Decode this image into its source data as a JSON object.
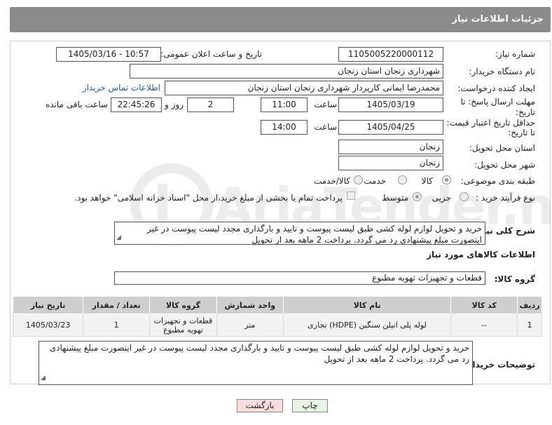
{
  "page": {
    "title": "جزئیات اطلاعات نیاز"
  },
  "fields": {
    "need_number_label": "شماره نیاز:",
    "need_number": "1105005220000112",
    "announce_label": "تاریخ و ساعت اعلان عمومی:",
    "announce_value": "1405/03/16 - 10:57",
    "buyer_org_label": "نام دستگاه خریدار:",
    "buyer_org": "شهرداری زنجان استان زنجان",
    "creator_label": "ایجاد کننده درخواست:",
    "creator": "محمدرضا  ایمانی کارپرداز شهرداری زنجان استان زنجان",
    "contact_link": "اطلاعات تماس خریدار",
    "deadline_label_1": "مهلت ارسال پاسخ: تا",
    "deadline_label_2": "تاریخ:",
    "deadline_date": "1405/03/19",
    "time_label": "ساعت",
    "deadline_time": "11:00",
    "days": "2",
    "days_label": "روز و",
    "remaining_time": "22:45:26",
    "remaining_label": "ساعت باقی مانده",
    "price_validity_label_1": "حداقل تاریخ اعتبار قیمت:",
    "price_validity_label_2": "تا تاریخ:",
    "price_validity_date": "1405/04/25",
    "price_validity_time": "14:00",
    "province_label": "استان محل تحویل:",
    "province": "زنجان",
    "city_label": "شهر محل تحویل:",
    "city": "زنجان",
    "category_label": "طبقه بندی موضوعی:",
    "category_options": [
      "کالا",
      "خدمت",
      "کالا/خدمت"
    ],
    "process_label": "نوع فرآیند خرید :",
    "process_options": [
      "جزیی",
      "متوسط"
    ],
    "payment_note": "پرداخت تمام یا بخشی از مبلغ خرید،از محل \"اسناد خزانه اسلامی\" خواهد بود.",
    "description_label": "شرح کلی نیاز:",
    "description": "خرید و تحویل لوازم لوله کشی طبق لیست پیوست و تایید و بارگذاری مجدد لیست پیوست در غیر اینصورت مبلغ پیشنهادی رد می گردد. پرداخت 2 ماهه بعد از تحویل",
    "goods_info_title": "اطلاعات کالاهای مورد نیاز",
    "goods_group_label": "گروه کالا:",
    "goods_group": "قطعات و تجهیزات تهویه مطبوع",
    "buyer_notes_label": "توضیحات خریدار:",
    "buyer_notes": "خرید و تحویل لوازم لوله کشی طبق لیست پیوست و تایید و بارگذاری مجدد لیست پیوست در غیر اینصورت مبلغ پیشنهادی رد می گردد. پرداخت 2 ماهه بعد از تحویل"
  },
  "table": {
    "headers": [
      "ردیف",
      "کد کالا",
      "نام کالا",
      "واحد شمارش",
      "گروه کالا",
      "تعداد / مقدار",
      "تاریخ نیاز"
    ],
    "rows": [
      [
        "1",
        "--",
        "لوله پلی اتیلن سنگین (HDPE) تجاری",
        "متر",
        "قطعات و تجهیزات تهویه مطبوع",
        "1",
        "1405/03/23"
      ]
    ]
  },
  "buttons": {
    "print": "چاپ",
    "back": "بازگشت"
  },
  "colors": {
    "titlebar": "#8b8b8b",
    "link": "#1a5db3",
    "header_cell": "#cfcfcf",
    "back_button": "#f9dede",
    "print_button": "#e6f5e3"
  },
  "watermark": {
    "text": "AriaTender.neT"
  }
}
